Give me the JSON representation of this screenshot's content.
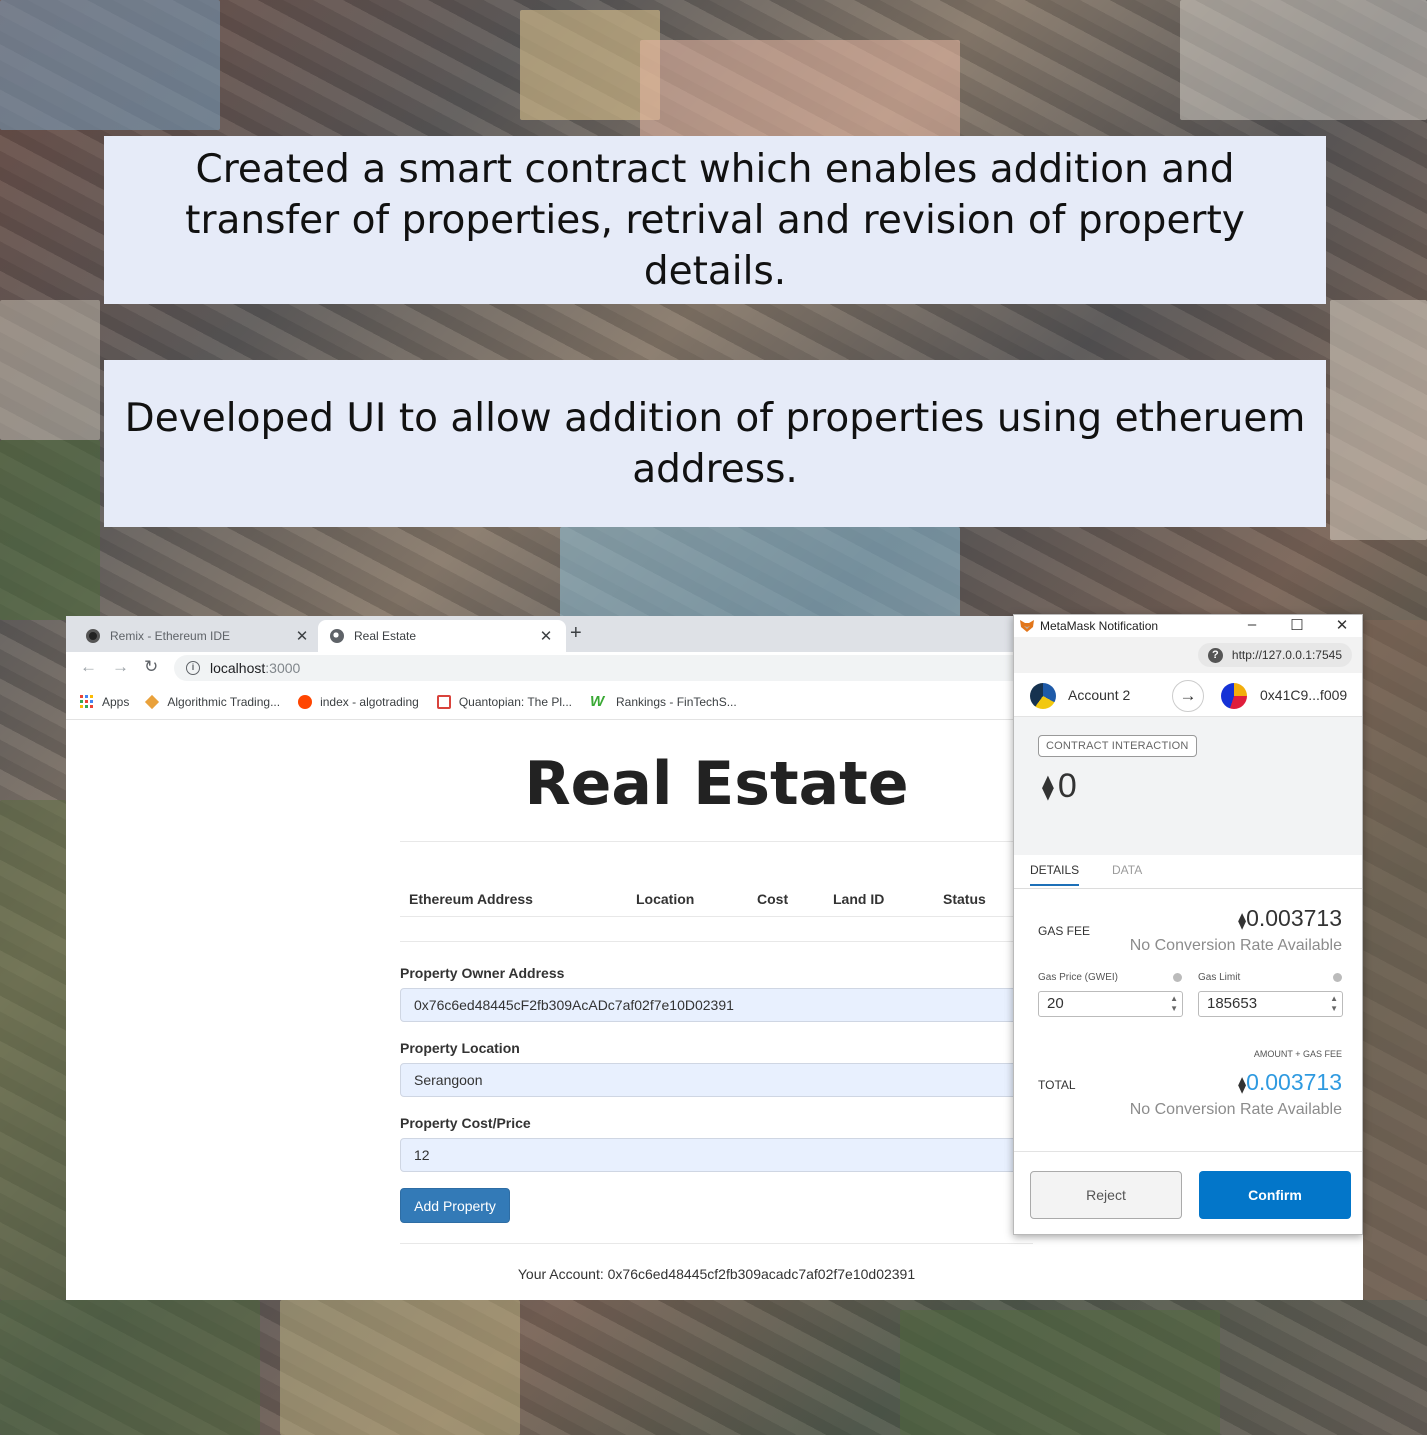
{
  "captions": {
    "first": "Created a smart contract which enables addition and transfer of properties, retrival and revision of property details.",
    "second": "Developed UI to allow addition of properties using etheruem address."
  },
  "browser": {
    "tabs": [
      {
        "title": "Remix - Ethereum IDE",
        "icon": "remix-icon"
      },
      {
        "title": "Real Estate",
        "icon": "globe-icon"
      }
    ],
    "new_tab": "+",
    "url_host": "localhost",
    "url_port": ":3000",
    "bookmarks": [
      {
        "label": "Apps",
        "icon": "apps-icon"
      },
      {
        "label": "Algorithmic Trading...",
        "icon": "algo-icon"
      },
      {
        "label": "index - algotrading",
        "icon": "reddit-icon"
      },
      {
        "label": "Quantopian: The Pl...",
        "icon": "quantopian-icon"
      },
      {
        "label": "Rankings - FinTechS...",
        "icon": "w-icon"
      }
    ]
  },
  "page": {
    "title": "Real Estate",
    "table_headers": [
      "Ethereum Address",
      "Location",
      "Cost",
      "Land ID",
      "Status"
    ],
    "owner_label": "Property Owner Address",
    "owner_value": "0x76c6ed48445cF2fb309AcADc7af02f7e10D02391",
    "location_label": "Property Location",
    "location_value": "Serangoon",
    "cost_label": "Property Cost/Price",
    "cost_value": "12",
    "add_button": "Add Property",
    "account_line": "Your Account: 0x76c6ed48445cf2fb309acadc7af02f7e10d02391"
  },
  "metamask": {
    "window_title": "MetaMask Notification",
    "url": "http://127.0.0.1:7545",
    "from_account": "Account 2",
    "to_account": "0x41C9...f009",
    "badge": "CONTRACT INTERACTION",
    "amount": "0",
    "tabs": [
      "DETAILS",
      "DATA"
    ],
    "gas_fee_label": "GAS FEE",
    "gas_fee_value": "0.003713",
    "no_rate": "No Conversion Rate Available",
    "gas_price_label": "Gas Price (GWEI)",
    "gas_price_value": "20",
    "gas_limit_label": "Gas Limit",
    "gas_limit_value": "185653",
    "amount_gas_label": "AMOUNT + GAS FEE",
    "total_label": "TOTAL",
    "total_value": "0.003713",
    "reject": "Reject",
    "confirm": "Confirm",
    "total_color": "#2f9ae0"
  }
}
